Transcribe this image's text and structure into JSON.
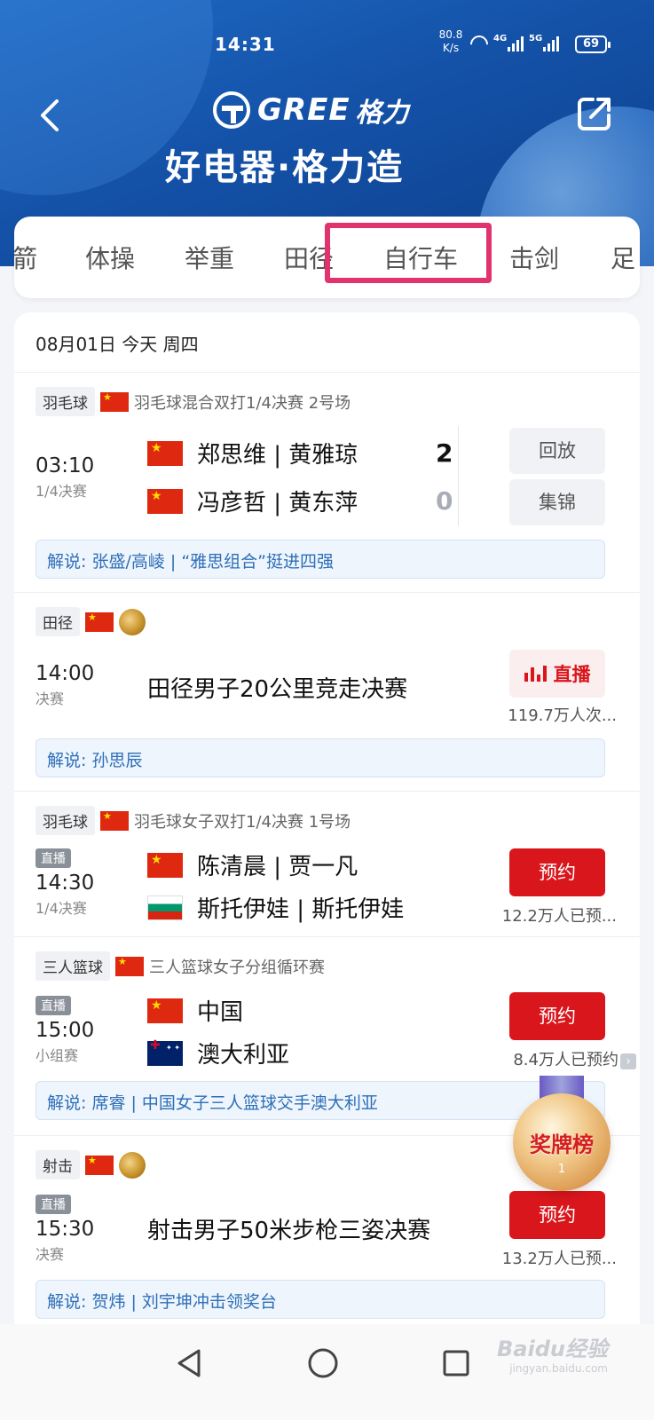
{
  "status_bar": {
    "time": "14:31",
    "net_speed_value": "80.8",
    "net_speed_unit": "K/s",
    "net1": "4G",
    "net2": "5G",
    "battery": "69"
  },
  "header": {
    "brand": "GREE",
    "brand_cn": "格力",
    "slogan": "好电器·格力造",
    "background_color": "#1452a8"
  },
  "tabs": [
    {
      "label": "箭"
    },
    {
      "label": "体操"
    },
    {
      "label": "举重"
    },
    {
      "label": "田径"
    },
    {
      "label": "自行车"
    },
    {
      "label": "击剑"
    },
    {
      "label": "足"
    }
  ],
  "highlight_color": "#e0336f",
  "date_header": "08月01日 今天 周四",
  "matches": [
    {
      "sport": "羽毛球",
      "event": "羽毛球混合双打1/4决赛 2号场",
      "time": "03:10",
      "round": "1/4决赛",
      "team1": {
        "name": "郑思维 | 黄雅琼",
        "score": "2"
      },
      "team2": {
        "name": "冯彦哲 | 黄东萍",
        "score": "0"
      },
      "btn1": "回放",
      "btn2": "集锦",
      "commentary": "解说: 张盛/高崚 | “雅思组合”挺进四强"
    },
    {
      "sport": "田径",
      "time": "14:00",
      "round": "决赛",
      "title": "田径男子20公里竞走决赛",
      "btn": "直播",
      "count": "119.7万人次...",
      "commentary": "解说: 孙思辰"
    },
    {
      "sport": "羽毛球",
      "event": "羽毛球女子双打1/4决赛 1号场",
      "live_tag": "直播",
      "time": "14:30",
      "round": "1/4决赛",
      "team1": {
        "name": "陈清晨 | 贾一凡"
      },
      "team2": {
        "name": "斯托伊娃 | 斯托伊娃"
      },
      "btn": "预约",
      "count": "12.2万人已预..."
    },
    {
      "sport": "三人篮球",
      "event": "三人篮球女子分组循环赛",
      "live_tag": "直播",
      "time": "15:00",
      "round": "小组赛",
      "team1": {
        "name": "中国"
      },
      "team2": {
        "name": "澳大利亚"
      },
      "btn": "预约",
      "count": "8.4万人已预约",
      "commentary": "解说: 席睿 | 中国女子三人篮球交手澳大利亚"
    },
    {
      "sport": "射击",
      "live_tag": "直播",
      "time": "15:30",
      "round": "决赛",
      "title": "射击男子50米步枪三姿决赛",
      "btn": "预约",
      "count": "13.2万人已预...",
      "commentary": "解说: 贺炜 | 刘宇坤冲击领奖台"
    }
  ],
  "medal_badge": {
    "label": "奖牌榜",
    "rank": "1"
  },
  "watermark": {
    "text": "Baidu经验",
    "sub": "jingyan.baidu.com"
  },
  "colors": {
    "accent_red": "#d9161c",
    "commentary_blue": "#2e6fb8"
  }
}
